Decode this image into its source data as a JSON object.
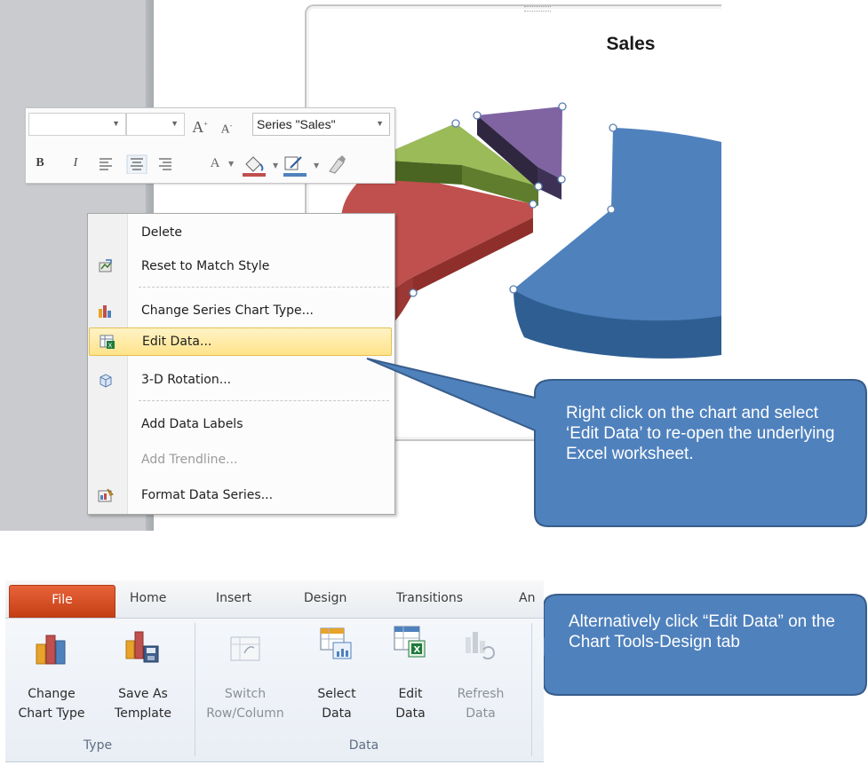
{
  "chart": {
    "title": "Sales",
    "slice_colors": {
      "blue": "#4f81bd",
      "red": "#c0504d",
      "green": "#9bbb59",
      "purple": "#8064a2"
    }
  },
  "mini_toolbar": {
    "series_selector": "Series \"Sales\"",
    "font_grow": "A",
    "font_shrink": "A",
    "bold": "B",
    "italic": "I"
  },
  "context_menu": {
    "items": [
      {
        "label": "Delete",
        "enabled": true
      },
      {
        "label": "Reset to Match Style",
        "enabled": true
      },
      {
        "label": "Change Series Chart Type...",
        "enabled": true
      },
      {
        "label": "Edit Data...",
        "enabled": true,
        "highlighted": true
      },
      {
        "label": "3-D Rotation...",
        "enabled": true
      },
      {
        "label": "Add Data Labels",
        "enabled": true
      },
      {
        "label": "Add Trendline...",
        "enabled": false
      },
      {
        "label": "Format Data Series...",
        "enabled": true
      }
    ]
  },
  "callouts": {
    "top": "Right click on the chart and select ‘Edit Data’ to re-open the underlying Excel worksheet.",
    "bottom": "Alternatively click “Edit Data” on the Chart Tools-Design tab",
    "fill_color": "#4f81bd",
    "border_color": "#385d8a"
  },
  "ribbon": {
    "tabs": [
      "File",
      "Home",
      "Insert",
      "Design",
      "Transitions",
      "An"
    ],
    "file_tab_color": "#d24d1f",
    "groups": [
      {
        "label": "Type",
        "buttons": [
          {
            "line1": "Change",
            "line2": "Chart Type",
            "icon": "change-chart-type-icon"
          },
          {
            "line1": "Save As",
            "line2": "Template",
            "icon": "save-as-template-icon"
          }
        ]
      },
      {
        "label": "Data",
        "buttons": [
          {
            "line1": "Switch",
            "line2": "Row/Column",
            "icon": "switch-row-column-icon",
            "enabled": false
          },
          {
            "line1": "Select",
            "line2": "Data",
            "icon": "select-data-icon",
            "enabled": true
          },
          {
            "line1": "Edit",
            "line2": "Data",
            "icon": "edit-data-icon",
            "enabled": true
          },
          {
            "line1": "Refresh",
            "line2": "Data",
            "icon": "refresh-data-icon",
            "enabled": false
          }
        ]
      }
    ]
  }
}
